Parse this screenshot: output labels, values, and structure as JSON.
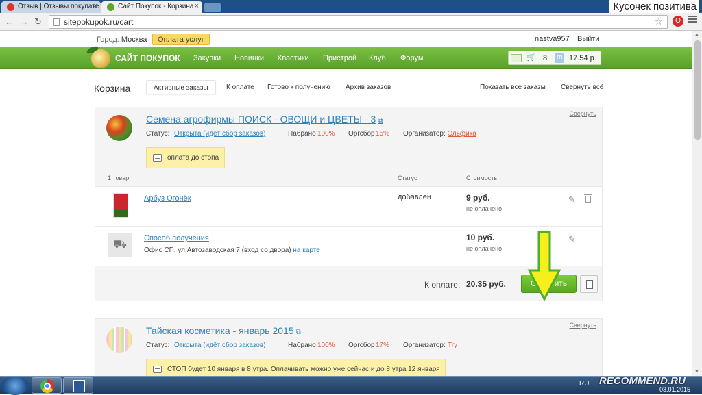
{
  "browser": {
    "tabs": [
      {
        "title": "Отзыв | Отзывы покупате",
        "favicon_color": "#d9352a"
      },
      {
        "title": "Сайт Покупок - Корзина",
        "favicon_color": "#5aa82b"
      }
    ],
    "corner_caption": "Кусочек позитива",
    "url": "sitepokupok.ru/cart",
    "opera_label": "O"
  },
  "site": {
    "city_label": "Город:",
    "city": "Москва",
    "pay_services": "Оплата услуг",
    "username": "nastva957",
    "logout": "Выйти",
    "logo": "САЙТ ПОКУПОК",
    "nav": [
      "Закупки",
      "Новинки",
      "Хвастики",
      "Пристрой",
      "Клуб",
      "Форум"
    ],
    "cart_count": "8",
    "m_label": "m",
    "balance": "17.54 р.",
    "accent_green": "#5aa82b"
  },
  "cart": {
    "title": "Корзина",
    "tabs": [
      "Активные заказы",
      "К оплате",
      "Готово к получению",
      "Архив заказов"
    ],
    "show_all_prefix": "Показать",
    "show_all_link": "все заказы",
    "collapse_all": "Свернуть всё"
  },
  "orders": [
    {
      "title": "Семена агрофирмы ПОИСК - ОВОЩИ и ЦВЕТЫ - 3",
      "collapse": "Свернуть",
      "status_label": "Статус:",
      "status": "Открыта (идёт сбор заказов)",
      "collected_label": "Набрано",
      "collected": "100%",
      "fee_label": "Оргсбор",
      "fee": "15%",
      "organizer_label": "Организатор:",
      "organizer": "Эльфика",
      "note": "оплата до стопа",
      "columns": [
        "1 товар",
        "Статус",
        "Стоимость"
      ],
      "items": [
        {
          "name": "Арбуз Огонёк",
          "status": "добавлен",
          "price": "9 руб.",
          "payment": "не оплачено"
        }
      ],
      "delivery": {
        "name": "Способ получения",
        "address": "Офис СП, ул.Автозаводская 7 (вход со двора)",
        "map_link": "на карте",
        "price": "10 руб.",
        "payment": "не оплачено"
      },
      "total_label": "К оплате:",
      "total": "20.35 руб.",
      "pay_button": "Оплатить"
    },
    {
      "title": "Тайская косметика - январь 2015",
      "collapse": "Свернуть",
      "status_label": "Статус:",
      "status": "Открыта (идёт сбор заказов)",
      "collected_label": "Набрано",
      "collected": "100%",
      "fee_label": "Оргсбор",
      "fee": "17%",
      "organizer_label": "Организатор:",
      "organizer": "Try",
      "note": "СТОП будет 10 января в 8 утра. Оплачивать можно уже сейчас и до 8 утра 12 января"
    }
  ],
  "taskbar": {
    "lang": "RU",
    "watermark": "RECOMMEND.RU",
    "date": "03.01.2015"
  },
  "annotation_arrow_color": "#f5ef1c"
}
